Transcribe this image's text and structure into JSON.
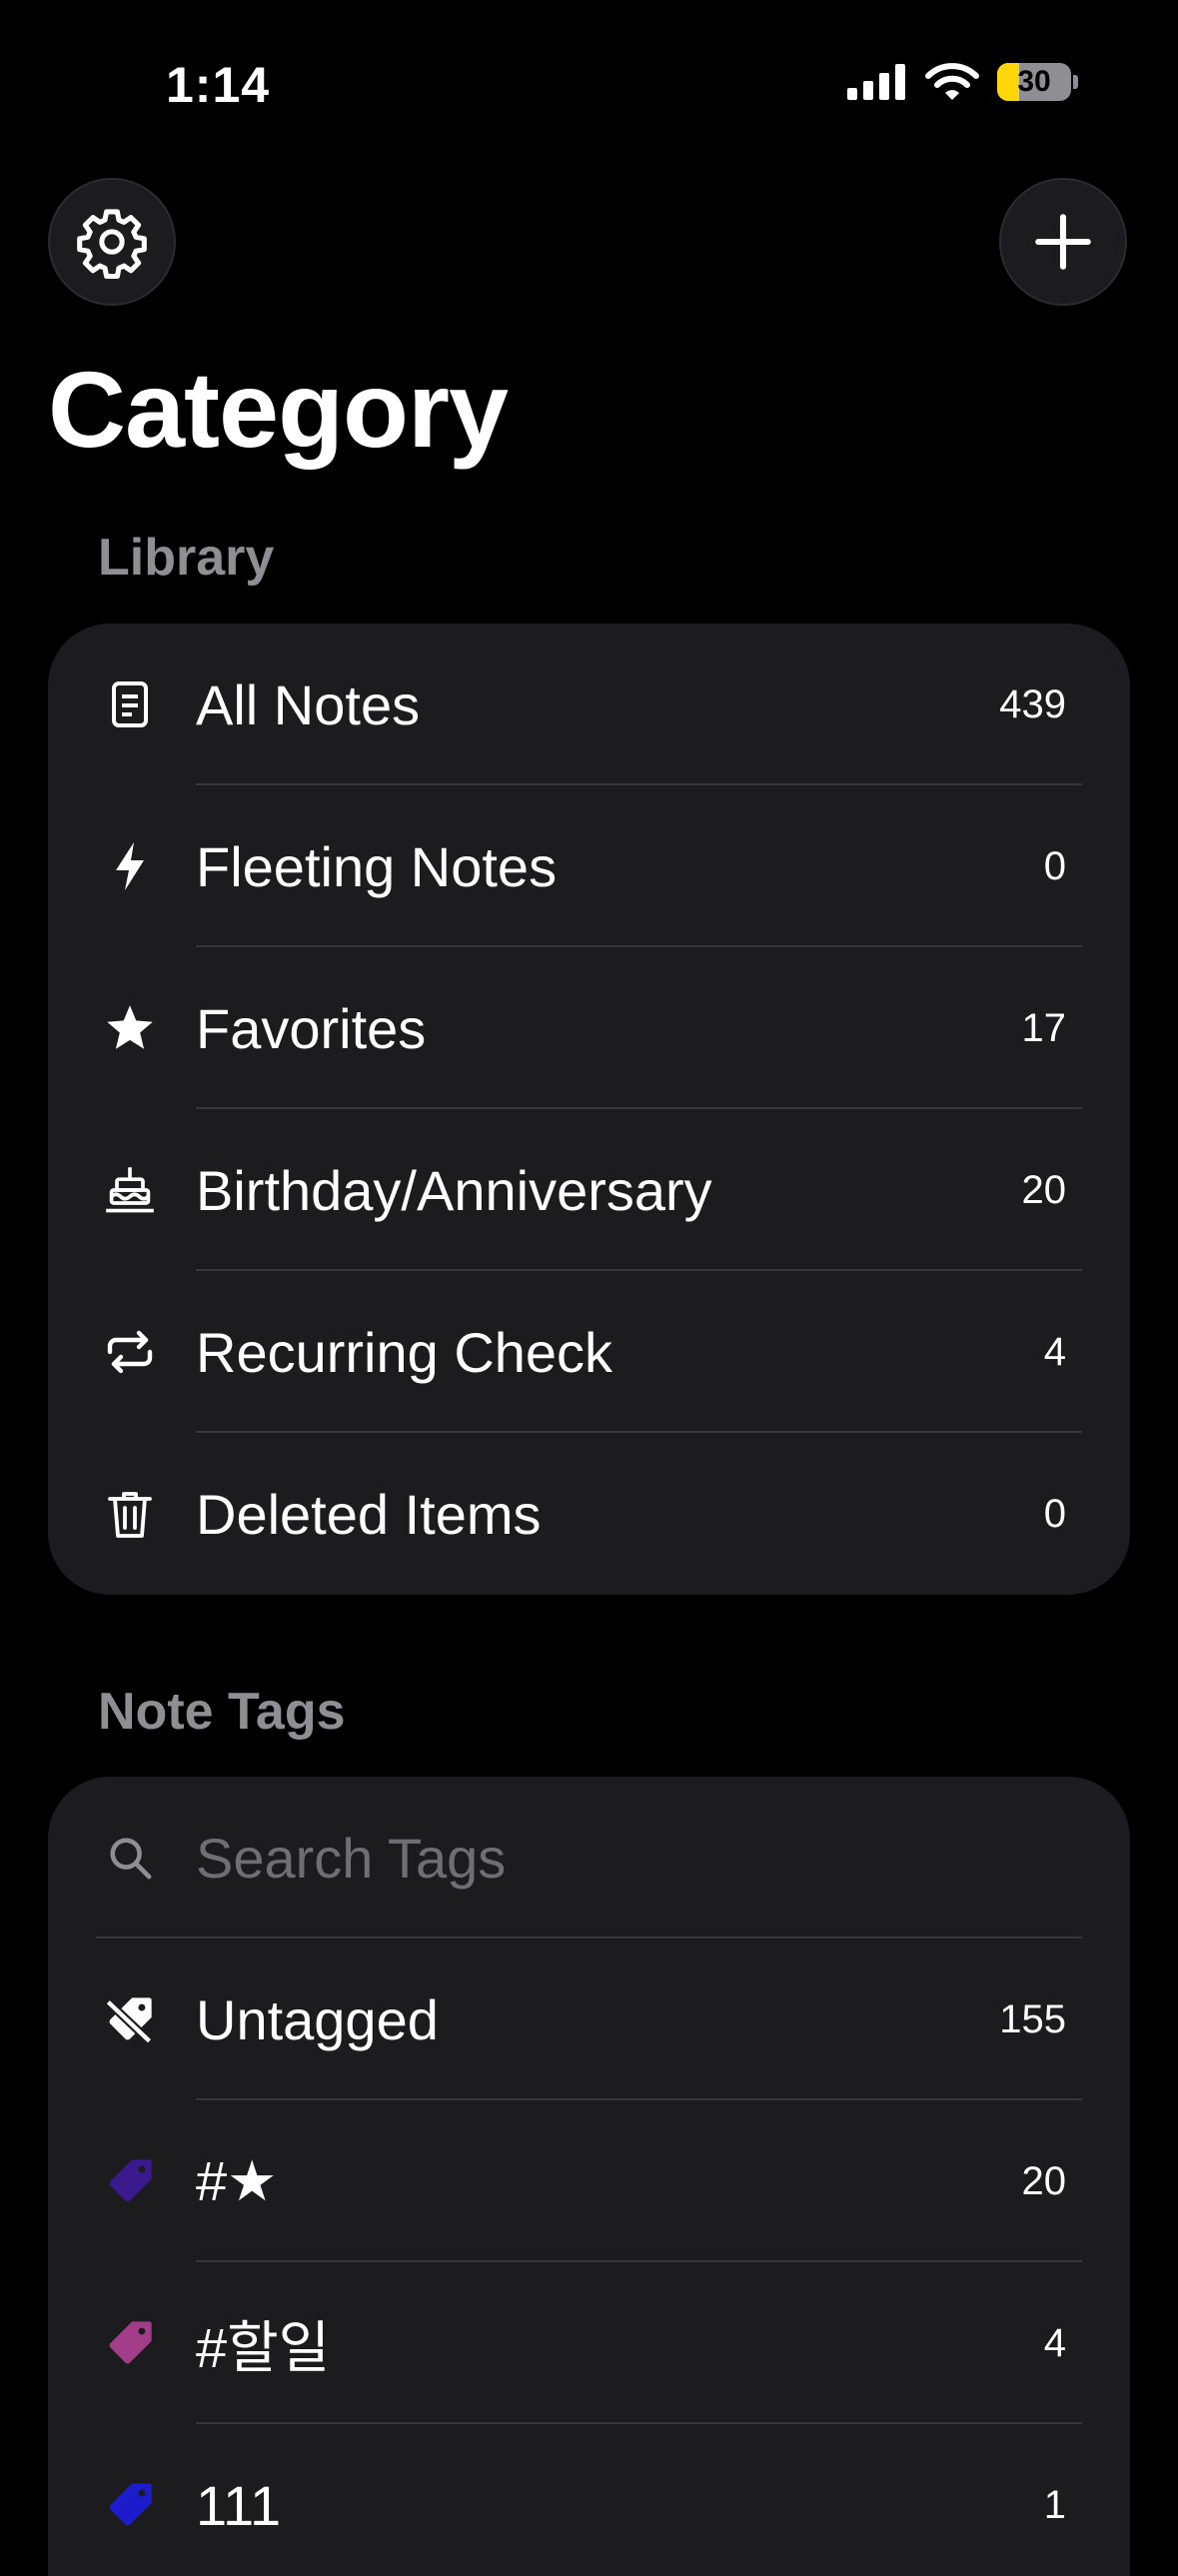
{
  "status_bar": {
    "time": "1:14",
    "battery": "30",
    "battery_level": 0.3
  },
  "header": {
    "title": "Category",
    "settings_icon": "gear-icon",
    "add_icon": "plus-icon"
  },
  "library": {
    "heading": "Library",
    "items": [
      {
        "icon": "note-icon",
        "label": "All Notes",
        "count": "439"
      },
      {
        "icon": "bolt-icon",
        "label": "Fleeting Notes",
        "count": "0"
      },
      {
        "icon": "star-icon",
        "label": "Favorites",
        "count": "17"
      },
      {
        "icon": "cake-icon",
        "label": "Birthday/Anniversary",
        "count": "20"
      },
      {
        "icon": "repeat-icon",
        "label": "Recurring Check",
        "count": "4"
      },
      {
        "icon": "trash-icon",
        "label": "Deleted Items",
        "count": "0"
      }
    ]
  },
  "note_tags": {
    "heading": "Note Tags",
    "search_placeholder": "Search Tags",
    "items": [
      {
        "icon": "untagged-icon",
        "label": "Untagged",
        "count": "155"
      },
      {
        "icon": "tag-icon",
        "label": "#★",
        "count": "20",
        "color": "#3a1a8c"
      },
      {
        "icon": "tag-icon",
        "label": "#할일",
        "count": "4",
        "color": "#a33d8a"
      },
      {
        "icon": "tag-icon",
        "label": "111",
        "count": "1",
        "color": "#1c1ccc"
      }
    ]
  }
}
